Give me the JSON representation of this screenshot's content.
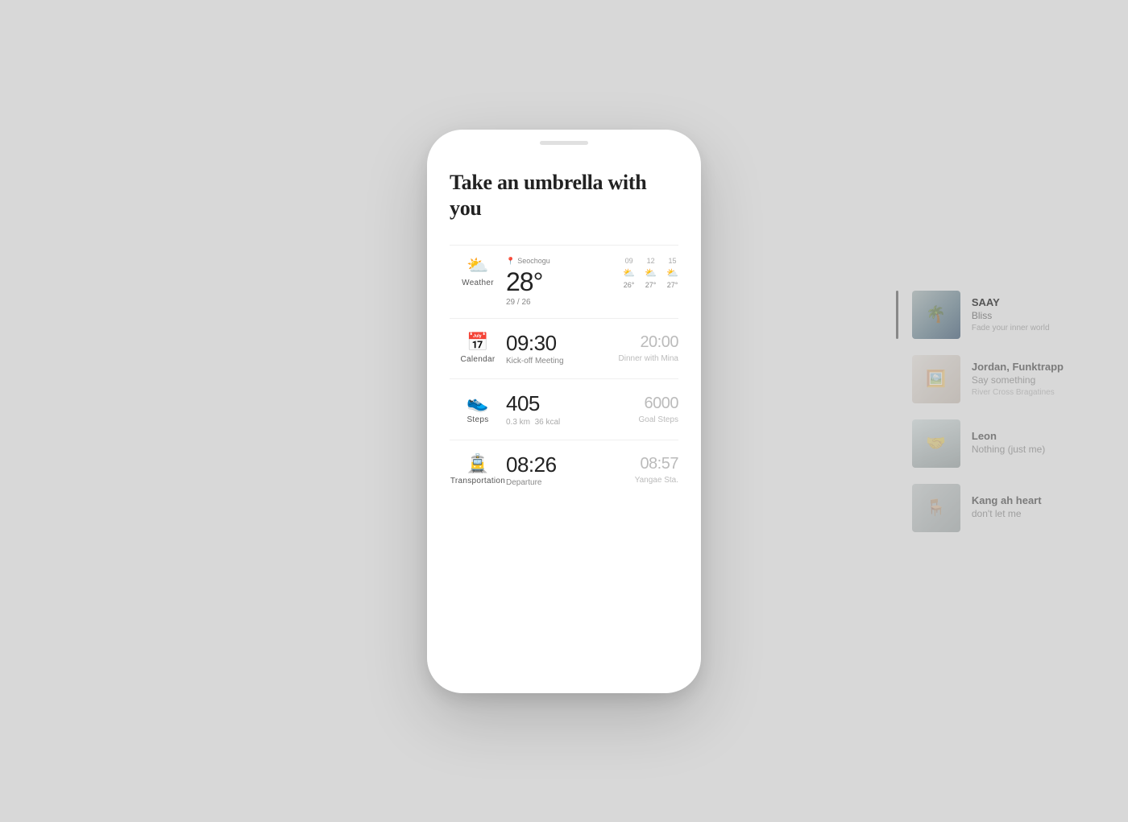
{
  "background": "#d8d8d8",
  "phone": {
    "hero_title": "Take an umbrella with you",
    "cards": {
      "weather": {
        "label": "Weather",
        "location": "Seochogu",
        "temp": "28°",
        "range": "29 / 26",
        "forecast": [
          {
            "hour": "09",
            "temp": "26°"
          },
          {
            "hour": "12",
            "temp": "27°"
          },
          {
            "hour": "15",
            "temp": "27°"
          }
        ]
      },
      "calendar": {
        "label": "Calendar",
        "time1": "09:30",
        "event1": "Kick-off Meeting",
        "time2": "20:00",
        "event2": "Dinner with Mina"
      },
      "steps": {
        "label": "Steps",
        "count": "405",
        "distance": "0.3 km",
        "kcal": "36 kcal",
        "goal": "6000",
        "goal_label": "Goal Steps"
      },
      "transportation": {
        "label": "Transportation",
        "time1": "08:26",
        "label1": "Departure",
        "time2": "08:57",
        "label2": "Yangae Sta."
      }
    }
  },
  "side_panel": {
    "tracks": [
      {
        "artist": "SAAY",
        "song": "Bliss",
        "desc": "Fade your inner world",
        "active": true
      },
      {
        "artist": "Jordan, Funktrapp",
        "song": "Say something",
        "desc": "River Cross Bragatines",
        "active": false
      },
      {
        "artist": "Leon",
        "song": "Nothing (just me)",
        "desc": "",
        "active": false
      },
      {
        "artist": "Kang ah heart",
        "song": "don't let me",
        "desc": "",
        "active": false
      }
    ]
  }
}
